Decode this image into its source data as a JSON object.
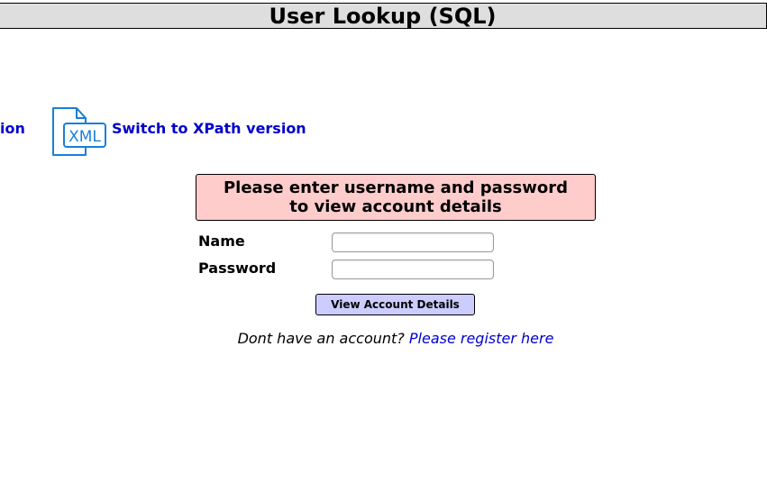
{
  "header": {
    "title": "User Lookup (SQL)"
  },
  "switch_links": {
    "left_partial_label": "ion",
    "xml_icon_text": "XML",
    "xpath_label": "Switch to XPath version"
  },
  "message": {
    "line1": "Please enter username and password",
    "line2": "to view account details"
  },
  "form": {
    "name_label": "Name",
    "name_value": "",
    "password_label": "Password",
    "password_value": "",
    "submit_label": "View Account Details"
  },
  "register": {
    "prompt": "Dont have an account?",
    "link_label": "Please register here"
  },
  "colors": {
    "title_bar": "#dedede",
    "message_bg": "#ffcccc",
    "button_bg": "#ccccff",
    "link": "#0000cc",
    "icon": "#1a7fd6"
  }
}
